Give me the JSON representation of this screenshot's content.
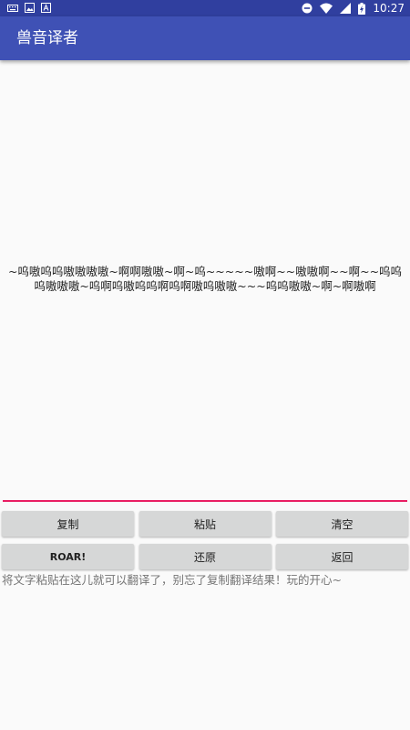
{
  "status_bar": {
    "time": "10:27",
    "icons": [
      "keyboard-icon",
      "image-icon",
      "text-a-icon",
      "do-not-disturb-icon",
      "wifi-icon",
      "signal-icon",
      "battery-charging-icon"
    ]
  },
  "app_bar": {
    "title": "兽音译者"
  },
  "output": {
    "text": "~呜嗷呜呜嗷嗷嗷嗷~啊啊嗷嗷~啊~呜~~~~~嗷啊~~嗷嗷啊~~啊~~呜呜呜嗷嗷嗷~呜啊呜嗷呜呜啊呜啊嗷呜嗷嗷~~~呜呜嗷嗷~啊~啊嗷啊"
  },
  "buttons": {
    "copy": "复制",
    "paste": "粘贴",
    "clear": "清空",
    "roar": "ROAR!",
    "restore": "还原",
    "back": "返回"
  },
  "hint": {
    "text": "将文字粘贴在这儿就可以翻译了，别忘了复制翻译结果！玩的开心~"
  },
  "colors": {
    "status_bar": "#303f9f",
    "app_bar": "#3f51b5",
    "accent": "#e91e63",
    "button": "#d6d7d7"
  }
}
